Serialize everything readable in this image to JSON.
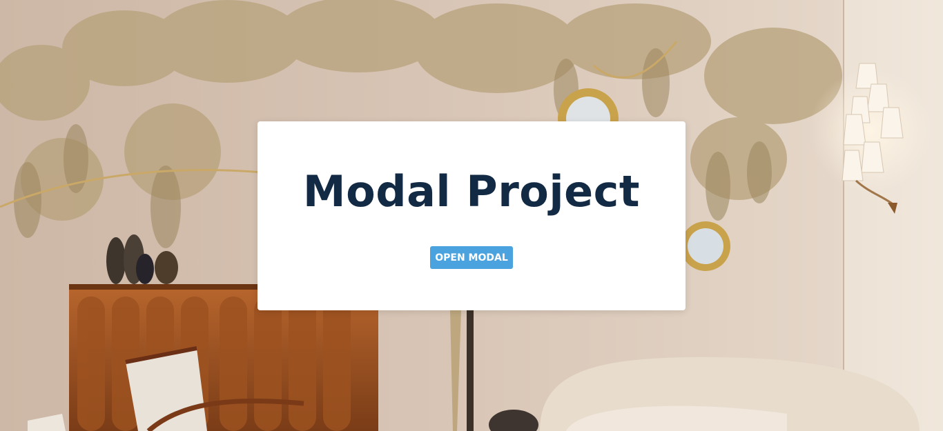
{
  "page": {
    "background_description_colors": {
      "wall": "#d8c8b8",
      "sideboard": "#a0522d",
      "sofa": "#e8dccf",
      "foliage": "#b9a37c"
    }
  },
  "modal_trigger_card": {
    "title": "Modal Project",
    "button_label": "OPEN MODAL",
    "title_color": "#132a45",
    "button_color": "#4aa3df"
  }
}
